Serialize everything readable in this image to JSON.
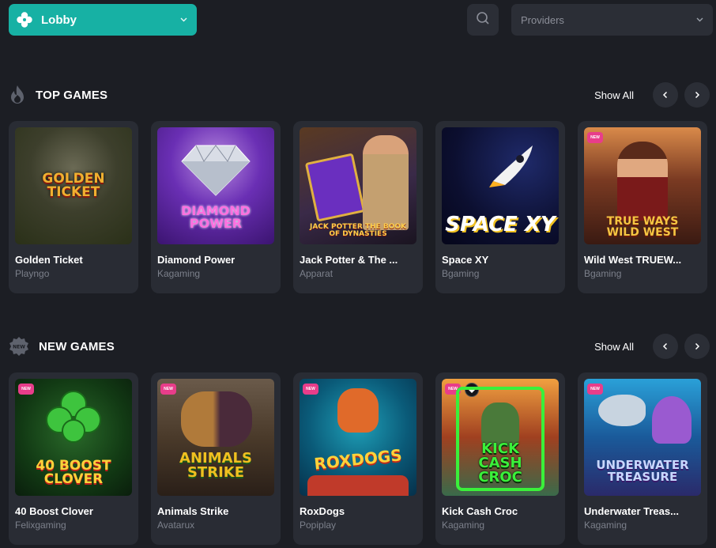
{
  "header": {
    "lobby_label": "Lobby",
    "providers_placeholder": "Providers"
  },
  "colors": {
    "accent": "#17b1a4",
    "background": "#1c1e24",
    "card": "#292c34",
    "new_badge": "#e83d8a"
  },
  "top_games": {
    "title": "TOP GAMES",
    "show_all": "Show All",
    "icon": "flame-icon",
    "games": [
      {
        "name": "Golden Ticket",
        "provider": "Playngo",
        "art": "GOLDEN TICKET",
        "new": false
      },
      {
        "name": "Diamond Power",
        "provider": "Kagaming",
        "art": "DIAMOND POWER",
        "new": false
      },
      {
        "name": "Jack Potter & The ...",
        "provider": "Apparat",
        "art": "JACK POTTER The BOOK of DYNASTIES",
        "new": false
      },
      {
        "name": "Space XY",
        "provider": "Bgaming",
        "art": "SPACE XY",
        "new": false
      },
      {
        "name": "Wild West TRUEW...",
        "provider": "Bgaming",
        "art": "TRUE WAYS WILD WEST",
        "new": true
      }
    ]
  },
  "new_games": {
    "title": "NEW GAMES",
    "show_all": "Show All",
    "icon": "new-badge-icon",
    "games": [
      {
        "name": "40 Boost Clover",
        "provider": "Felixgaming",
        "art": "40 BOOST CLOVER",
        "new": true
      },
      {
        "name": "Animals Strike",
        "provider": "Avatarux",
        "art": "ANIMALS STRIKE",
        "new": true
      },
      {
        "name": "RoxDogs",
        "provider": "Popiplay",
        "art": "ROXDOGS",
        "new": true
      },
      {
        "name": "Kick Cash Croc",
        "provider": "Kagaming",
        "art": "KICK CASH CROC",
        "new": true
      },
      {
        "name": "Underwater Treas...",
        "provider": "Kagaming",
        "art": "UNDERWATER TREASURE",
        "new": true
      }
    ]
  },
  "badge_new_text": "NEW"
}
